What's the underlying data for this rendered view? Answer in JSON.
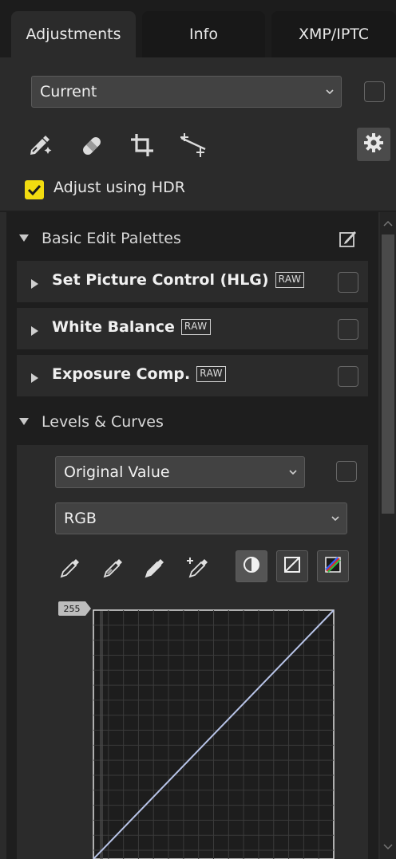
{
  "tabs": [
    {
      "label": "Adjustments",
      "active": true
    },
    {
      "label": "Info",
      "active": false
    },
    {
      "label": "XMP/IPTC",
      "active": false
    }
  ],
  "preset": {
    "value": "Current"
  },
  "tools": [
    "auto-retouch-brush-icon",
    "bandage-icon",
    "crop-icon",
    "straighten-icon",
    "gear-icon"
  ],
  "hdr": {
    "label": "Adjust using HDR",
    "checked": true,
    "color": "#f2dc10"
  },
  "basic_section": {
    "title": "Basic Edit Palettes",
    "expanded": true
  },
  "palettes": [
    {
      "title": "Set Picture Control (HLG)",
      "badge": "RAW"
    },
    {
      "title": "White Balance",
      "badge": "RAW"
    },
    {
      "title": "Exposure Comp.",
      "badge": "RAW"
    }
  ],
  "levels_section": {
    "title": "Levels & Curves",
    "expanded": true
  },
  "levels": {
    "mode_dropdown": "Original Value",
    "channel_dropdown": "RGB",
    "curve_tools": [
      "black-point-eyedropper-icon",
      "gray-point-eyedropper-icon",
      "white-point-eyedropper-icon",
      "add-anchor-eyedropper-icon"
    ],
    "view_modes": [
      "contrast-icon",
      "linear-curve-icon",
      "color-curve-icon"
    ],
    "max_output_label": "255",
    "curve_color": "#b8c4e8"
  }
}
